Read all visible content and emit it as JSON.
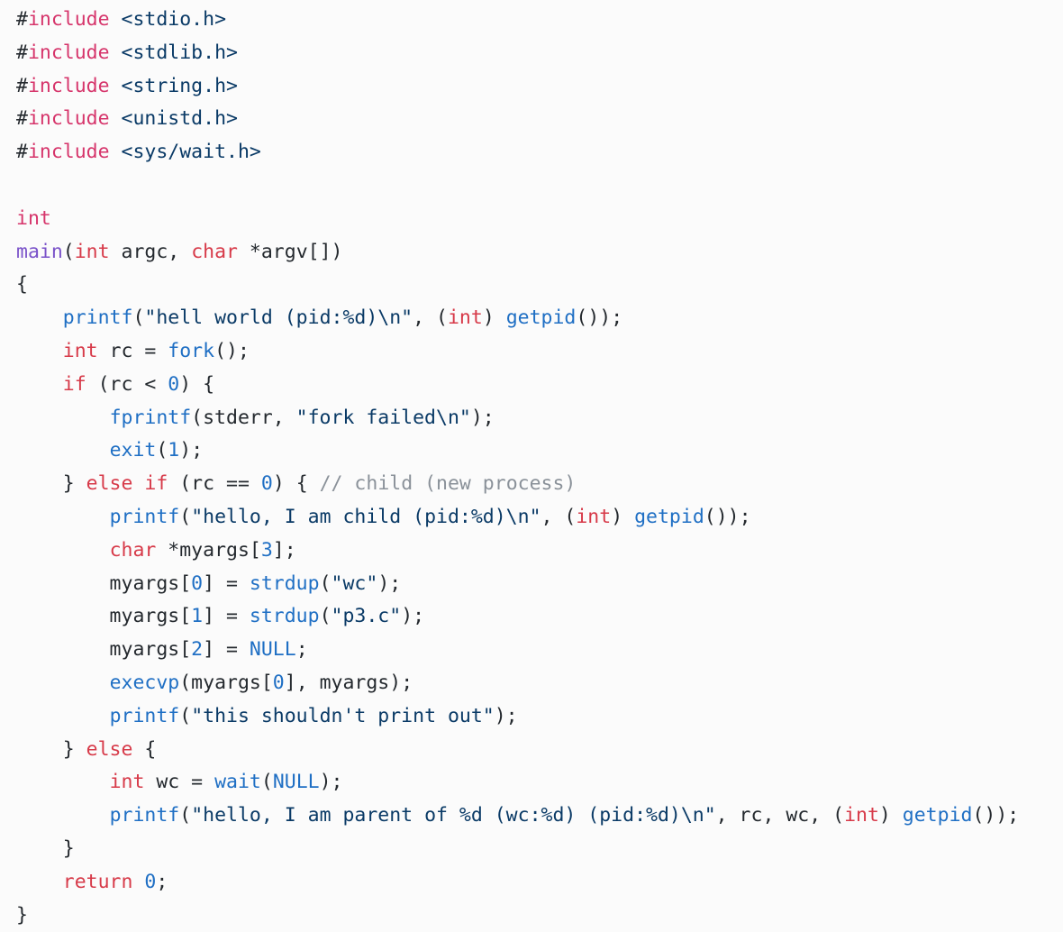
{
  "document": {
    "kind": "source-code-listing",
    "language": "c",
    "filename_referenced": "p3.c",
    "background_color": "#fbfbfb",
    "palette": {
      "plain": "#24292e",
      "keyword": "#d6356b",
      "keyword_type": "#d73a49",
      "function": "#1f6fc4",
      "entity": "#7a52c9",
      "string": "#0a3a66",
      "number": "#1f6fc4",
      "constant": "#1f6fc4",
      "comment": "#8a9199"
    }
  },
  "code": {
    "lines": [
      {
        "index": 1,
        "text": "#include <stdio.h>",
        "tokens": [
          {
            "t": "#",
            "c": "hash"
          },
          {
            "t": "include",
            "c": "keyword"
          },
          {
            "t": " ",
            "c": "plain"
          },
          {
            "t": "<stdio.h>",
            "c": "string"
          }
        ]
      },
      {
        "index": 2,
        "text": "#include <stdlib.h>",
        "tokens": [
          {
            "t": "#",
            "c": "hash"
          },
          {
            "t": "include",
            "c": "keyword"
          },
          {
            "t": " ",
            "c": "plain"
          },
          {
            "t": "<stdlib.h>",
            "c": "string"
          }
        ]
      },
      {
        "index": 3,
        "text": "#include <string.h>",
        "tokens": [
          {
            "t": "#",
            "c": "hash"
          },
          {
            "t": "include",
            "c": "keyword"
          },
          {
            "t": " ",
            "c": "plain"
          },
          {
            "t": "<string.h>",
            "c": "string"
          }
        ]
      },
      {
        "index": 4,
        "text": "#include <unistd.h>",
        "tokens": [
          {
            "t": "#",
            "c": "hash"
          },
          {
            "t": "include",
            "c": "keyword"
          },
          {
            "t": " ",
            "c": "plain"
          },
          {
            "t": "<unistd.h>",
            "c": "string"
          }
        ]
      },
      {
        "index": 5,
        "text": "#include <sys/wait.h>",
        "tokens": [
          {
            "t": "#",
            "c": "hash"
          },
          {
            "t": "include",
            "c": "keyword"
          },
          {
            "t": " ",
            "c": "plain"
          },
          {
            "t": "<sys/wait.h>",
            "c": "string"
          }
        ]
      },
      {
        "index": 6,
        "text": "",
        "tokens": []
      },
      {
        "index": 7,
        "text": "int",
        "tokens": [
          {
            "t": "int",
            "c": "keyword"
          }
        ]
      },
      {
        "index": 8,
        "text": "main(int argc, char *argv[])",
        "tokens": [
          {
            "t": "main",
            "c": "entity"
          },
          {
            "t": "(",
            "c": "punct"
          },
          {
            "t": "int",
            "c": "kw2"
          },
          {
            "t": " argc, ",
            "c": "plain"
          },
          {
            "t": "char",
            "c": "kw2"
          },
          {
            "t": " *argv[])",
            "c": "plain"
          }
        ]
      },
      {
        "index": 9,
        "text": "{",
        "tokens": [
          {
            "t": "{",
            "c": "punct"
          }
        ]
      },
      {
        "index": 10,
        "text": "    printf(\"hell world (pid:%d)\\n\", (int) getpid());",
        "tokens": [
          {
            "t": "    ",
            "c": "plain"
          },
          {
            "t": "printf",
            "c": "func"
          },
          {
            "t": "(",
            "c": "punct"
          },
          {
            "t": "\"hell world (pid:%d)\\n\"",
            "c": "string"
          },
          {
            "t": ", (",
            "c": "plain"
          },
          {
            "t": "int",
            "c": "kw2"
          },
          {
            "t": ") ",
            "c": "plain"
          },
          {
            "t": "getpid",
            "c": "func"
          },
          {
            "t": "());",
            "c": "plain"
          }
        ]
      },
      {
        "index": 11,
        "text": "    int rc = fork();",
        "tokens": [
          {
            "t": "    ",
            "c": "plain"
          },
          {
            "t": "int",
            "c": "kw2"
          },
          {
            "t": " rc = ",
            "c": "plain"
          },
          {
            "t": "fork",
            "c": "func"
          },
          {
            "t": "();",
            "c": "plain"
          }
        ]
      },
      {
        "index": 12,
        "text": "    if (rc < 0) {",
        "tokens": [
          {
            "t": "    ",
            "c": "plain"
          },
          {
            "t": "if",
            "c": "kw2"
          },
          {
            "t": " (rc < ",
            "c": "plain"
          },
          {
            "t": "0",
            "c": "number"
          },
          {
            "t": ") {",
            "c": "plain"
          }
        ]
      },
      {
        "index": 13,
        "text": "        fprintf(stderr, \"fork failed\\n\");",
        "tokens": [
          {
            "t": "        ",
            "c": "plain"
          },
          {
            "t": "fprintf",
            "c": "func"
          },
          {
            "t": "(stderr, ",
            "c": "plain"
          },
          {
            "t": "\"fork failed\\n\"",
            "c": "string"
          },
          {
            "t": ");",
            "c": "plain"
          }
        ]
      },
      {
        "index": 14,
        "text": "        exit(1);",
        "tokens": [
          {
            "t": "        ",
            "c": "plain"
          },
          {
            "t": "exit",
            "c": "func"
          },
          {
            "t": "(",
            "c": "punct"
          },
          {
            "t": "1",
            "c": "number"
          },
          {
            "t": ");",
            "c": "plain"
          }
        ]
      },
      {
        "index": 15,
        "text": "    } else if (rc == 0) { // child (new process)",
        "tokens": [
          {
            "t": "    } ",
            "c": "plain"
          },
          {
            "t": "else",
            "c": "kw2"
          },
          {
            "t": " ",
            "c": "plain"
          },
          {
            "t": "if",
            "c": "kw2"
          },
          {
            "t": " (rc == ",
            "c": "plain"
          },
          {
            "t": "0",
            "c": "number"
          },
          {
            "t": ") { ",
            "c": "plain"
          },
          {
            "t": "// child (new process)",
            "c": "comment"
          }
        ]
      },
      {
        "index": 16,
        "text": "        printf(\"hello, I am child (pid:%d)\\n\", (int) getpid());",
        "tokens": [
          {
            "t": "        ",
            "c": "plain"
          },
          {
            "t": "printf",
            "c": "func"
          },
          {
            "t": "(",
            "c": "punct"
          },
          {
            "t": "\"hello, I am child (pid:%d)\\n\"",
            "c": "string"
          },
          {
            "t": ", (",
            "c": "plain"
          },
          {
            "t": "int",
            "c": "kw2"
          },
          {
            "t": ") ",
            "c": "plain"
          },
          {
            "t": "getpid",
            "c": "func"
          },
          {
            "t": "());",
            "c": "plain"
          }
        ]
      },
      {
        "index": 17,
        "text": "        char *myargs[3];",
        "tokens": [
          {
            "t": "        ",
            "c": "plain"
          },
          {
            "t": "char",
            "c": "kw2"
          },
          {
            "t": " *myargs[",
            "c": "plain"
          },
          {
            "t": "3",
            "c": "number"
          },
          {
            "t": "];",
            "c": "plain"
          }
        ]
      },
      {
        "index": 18,
        "text": "        myargs[0] = strdup(\"wc\");",
        "tokens": [
          {
            "t": "        myargs[",
            "c": "plain"
          },
          {
            "t": "0",
            "c": "number"
          },
          {
            "t": "] = ",
            "c": "plain"
          },
          {
            "t": "strdup",
            "c": "func"
          },
          {
            "t": "(",
            "c": "punct"
          },
          {
            "t": "\"wc\"",
            "c": "string"
          },
          {
            "t": ");",
            "c": "plain"
          }
        ]
      },
      {
        "index": 19,
        "text": "        myargs[1] = strdup(\"p3.c\");",
        "tokens": [
          {
            "t": "        myargs[",
            "c": "plain"
          },
          {
            "t": "1",
            "c": "number"
          },
          {
            "t": "] = ",
            "c": "plain"
          },
          {
            "t": "strdup",
            "c": "func"
          },
          {
            "t": "(",
            "c": "punct"
          },
          {
            "t": "\"p3.c\"",
            "c": "string"
          },
          {
            "t": ");",
            "c": "plain"
          }
        ]
      },
      {
        "index": 20,
        "text": "        myargs[2] = NULL;",
        "tokens": [
          {
            "t": "        myargs[",
            "c": "plain"
          },
          {
            "t": "2",
            "c": "number"
          },
          {
            "t": "] = ",
            "c": "plain"
          },
          {
            "t": "NULL",
            "c": "const"
          },
          {
            "t": ";",
            "c": "plain"
          }
        ]
      },
      {
        "index": 21,
        "text": "        execvp(myargs[0], myargs);",
        "tokens": [
          {
            "t": "        ",
            "c": "plain"
          },
          {
            "t": "execvp",
            "c": "func"
          },
          {
            "t": "(myargs[",
            "c": "plain"
          },
          {
            "t": "0",
            "c": "number"
          },
          {
            "t": "], myargs);",
            "c": "plain"
          }
        ]
      },
      {
        "index": 22,
        "text": "        printf(\"this shouldn't print out\");",
        "tokens": [
          {
            "t": "        ",
            "c": "plain"
          },
          {
            "t": "printf",
            "c": "func"
          },
          {
            "t": "(",
            "c": "punct"
          },
          {
            "t": "\"this shouldn't print out\"",
            "c": "string"
          },
          {
            "t": ");",
            "c": "plain"
          }
        ]
      },
      {
        "index": 23,
        "text": "    } else {",
        "tokens": [
          {
            "t": "    } ",
            "c": "plain"
          },
          {
            "t": "else",
            "c": "kw2"
          },
          {
            "t": " {",
            "c": "plain"
          }
        ]
      },
      {
        "index": 24,
        "text": "        int wc = wait(NULL);",
        "tokens": [
          {
            "t": "        ",
            "c": "plain"
          },
          {
            "t": "int",
            "c": "kw2"
          },
          {
            "t": " wc = ",
            "c": "plain"
          },
          {
            "t": "wait",
            "c": "func"
          },
          {
            "t": "(",
            "c": "punct"
          },
          {
            "t": "NULL",
            "c": "const"
          },
          {
            "t": ");",
            "c": "plain"
          }
        ]
      },
      {
        "index": 25,
        "text": "        printf(\"hello, I am parent of %d (wc:%d) (pid:%d)\\n\", rc, wc, (int) getpid());",
        "tokens": [
          {
            "t": "        ",
            "c": "plain"
          },
          {
            "t": "printf",
            "c": "func"
          },
          {
            "t": "(",
            "c": "punct"
          },
          {
            "t": "\"hello, I am parent of %d (wc:%d) (pid:%d)\\n\"",
            "c": "string"
          },
          {
            "t": ", rc, wc, (",
            "c": "plain"
          },
          {
            "t": "int",
            "c": "kw2"
          },
          {
            "t": ") ",
            "c": "plain"
          },
          {
            "t": "getpid",
            "c": "func"
          },
          {
            "t": "());",
            "c": "plain"
          }
        ]
      },
      {
        "index": 26,
        "text": "    }",
        "tokens": [
          {
            "t": "    }",
            "c": "plain"
          }
        ]
      },
      {
        "index": 27,
        "text": "    return 0;",
        "tokens": [
          {
            "t": "    ",
            "c": "plain"
          },
          {
            "t": "return",
            "c": "kw2"
          },
          {
            "t": " ",
            "c": "plain"
          },
          {
            "t": "0",
            "c": "number"
          },
          {
            "t": ";",
            "c": "plain"
          }
        ]
      },
      {
        "index": 28,
        "text": "}",
        "tokens": [
          {
            "t": "}",
            "c": "punct"
          }
        ]
      }
    ]
  }
}
